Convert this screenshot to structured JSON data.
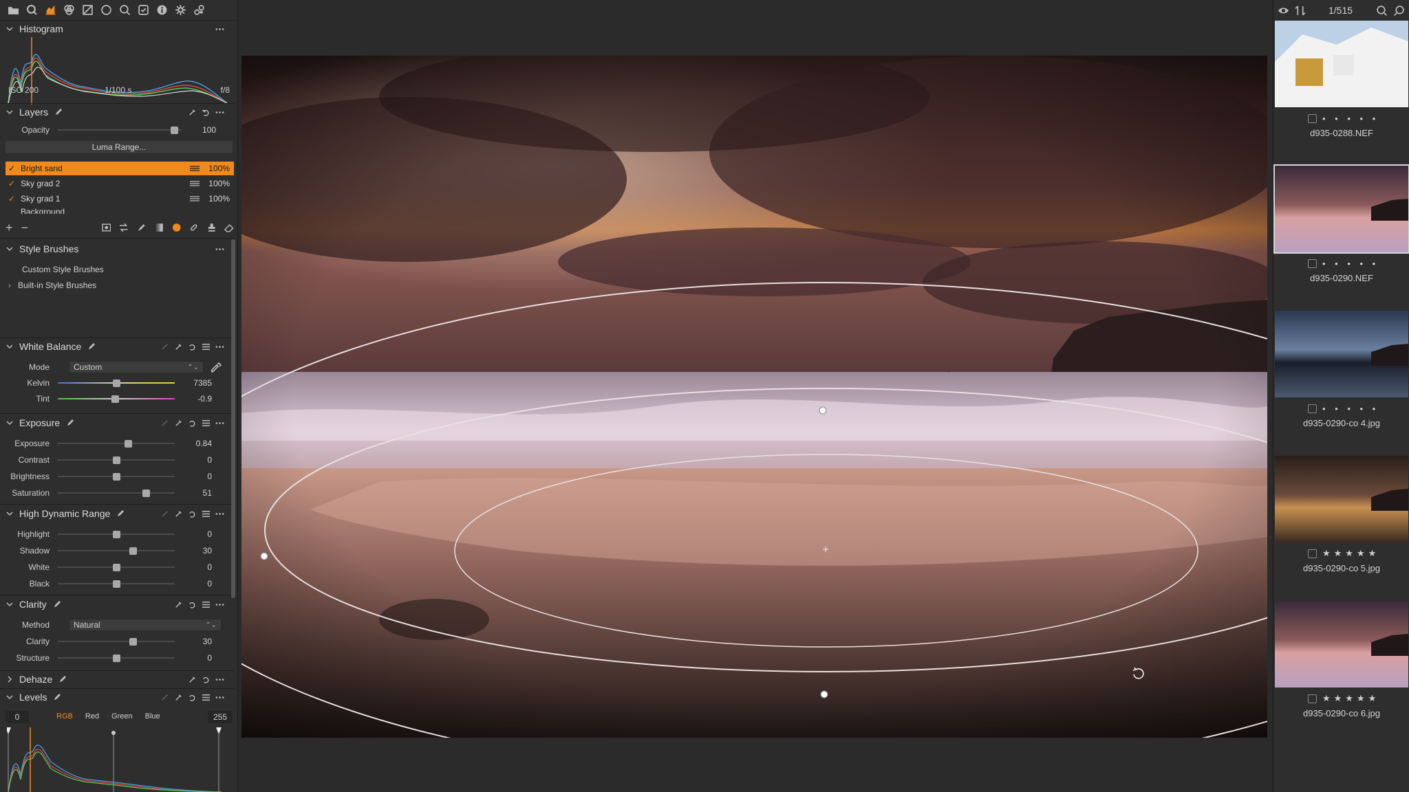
{
  "colors": {
    "accent": "#f08a1c",
    "panel_bg": "#2e2e2e",
    "viewer_bg": "#2b2b2b"
  },
  "tool_tabs": [
    "folder-icon",
    "search-icon",
    "color-icon",
    "layers-icon",
    "crop-icon",
    "lens-icon",
    "details-icon",
    "adjustments-icon",
    "metadata-icon",
    "settings-icon",
    "batch-icon"
  ],
  "histogram": {
    "title": "Histogram",
    "iso": "ISO 200",
    "shutter": "1/100 s",
    "aperture": "f/8"
  },
  "layers": {
    "title": "Layers",
    "opacity_label": "Opacity",
    "opacity_value": "100",
    "opacity_level": 1.0,
    "luma_button": "Luma Range...",
    "items": [
      {
        "name": "Bright sand",
        "pct": "100%",
        "selected": true
      },
      {
        "name": "Sky grad 2",
        "pct": "100%",
        "selected": false
      },
      {
        "name": "Sky grad 1",
        "pct": "100%",
        "selected": false
      },
      {
        "name": "Background",
        "pct": "",
        "selected": false
      }
    ]
  },
  "style_brushes": {
    "title": "Style Brushes",
    "custom": "Custom Style Brushes",
    "builtin": "Built-in Style Brushes"
  },
  "white_balance": {
    "title": "White Balance",
    "mode_label": "Mode",
    "mode_value": "Custom",
    "kelvin_label": "Kelvin",
    "kelvin_value": "7385",
    "tint_label": "Tint",
    "tint_value": "-0.9"
  },
  "exposure": {
    "title": "Exposure",
    "rows": [
      {
        "label": "Exposure",
        "value": "0.84",
        "level": 0.6
      },
      {
        "label": "Contrast",
        "value": "0",
        "level": 0.5
      },
      {
        "label": "Brightness",
        "value": "0",
        "level": 0.5
      },
      {
        "label": "Saturation",
        "value": "51",
        "level": 0.75
      }
    ]
  },
  "hdr": {
    "title": "High Dynamic Range",
    "rows": [
      {
        "label": "Highlight",
        "value": "0",
        "level": 0.5
      },
      {
        "label": "Shadow",
        "value": "30",
        "level": 0.64
      },
      {
        "label": "White",
        "value": "0",
        "level": 0.5
      },
      {
        "label": "Black",
        "value": "0",
        "level": 0.5
      }
    ]
  },
  "clarity": {
    "title": "Clarity",
    "method_label": "Method",
    "method_value": "Natural",
    "rows": [
      {
        "label": "Clarity",
        "value": "30",
        "level": 0.64
      },
      {
        "label": "Structure",
        "value": "0",
        "level": 0.5
      }
    ]
  },
  "dehaze": {
    "title": "Dehaze"
  },
  "levels": {
    "title": "Levels",
    "low": "0",
    "high": "255",
    "channels": [
      "RGB",
      "Red",
      "Green",
      "Blue"
    ],
    "active_channel": "RGB"
  },
  "browser": {
    "counter": "1/515",
    "items": [
      {
        "name": "d935-0288.NEF",
        "stars": "• • • • •",
        "selected": false
      },
      {
        "name": "d935-0290.NEF",
        "stars": "• • • • •",
        "selected": true
      },
      {
        "name": "d935-0290-co 4.jpg",
        "stars": "• • • • •",
        "selected": false
      },
      {
        "name": "d935-0290-co 5.jpg",
        "stars": "★★★★★",
        "selected": false
      },
      {
        "name": "d935-0290-co 6.jpg",
        "stars": "★★★★★",
        "selected": false
      }
    ]
  }
}
